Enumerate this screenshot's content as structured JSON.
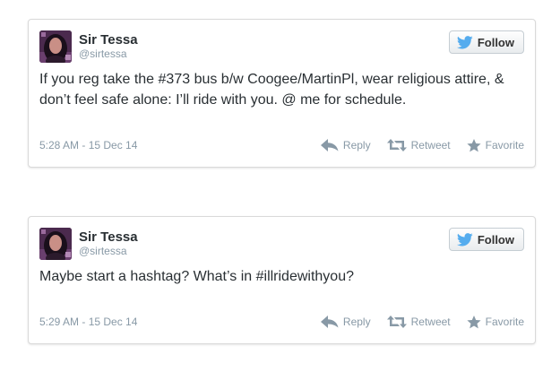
{
  "colors": {
    "text": "#292f33",
    "muted": "#8899a6",
    "twitter_blue": "#55acee",
    "border": "#d9d9d9"
  },
  "tweets": [
    {
      "user": {
        "name": "Sir Tessa",
        "handle": "@sirtessa",
        "avatar_icon": "user-avatar"
      },
      "follow_label": "Follow",
      "text": "If you reg take the #373 bus b/w Coogee/MartinPl, wear religious attire, & don’t feel safe alone: I’ll ride with you. @ me for schedule.",
      "timestamp": "5:28 AM - 15 Dec 14",
      "actions": {
        "reply": "Reply",
        "retweet": "Retweet",
        "favorite": "Favorite"
      }
    },
    {
      "user": {
        "name": "Sir Tessa",
        "handle": "@sirtessa",
        "avatar_icon": "user-avatar"
      },
      "follow_label": "Follow",
      "text": "Maybe start a hashtag? What’s in #illridewithyou?",
      "timestamp": "5:29 AM - 15 Dec 14",
      "actions": {
        "reply": "Reply",
        "retweet": "Retweet",
        "favorite": "Favorite"
      }
    }
  ]
}
